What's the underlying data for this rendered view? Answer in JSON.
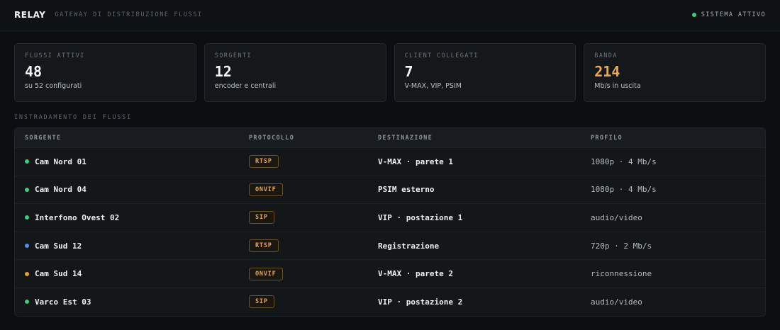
{
  "header": {
    "brand": "RELAY",
    "subtitle": "GATEWAY DI DISTRIBUZIONE FLUSSI",
    "status": "SISTEMA ATTIVO",
    "status_color": "#34d27b"
  },
  "cards": [
    {
      "label": "FLUSSI ATTIVI",
      "value": "48",
      "note": "su 52 configurati"
    },
    {
      "label": "SORGENTI",
      "value": "12",
      "note": "encoder e centrali"
    },
    {
      "label": "CLIENT COLLEGATI",
      "value": "7",
      "note": "V-MAX, VIP, PSIM"
    },
    {
      "label": "BANDA",
      "value": "214",
      "note": "Mb/s in uscita",
      "accent": "#f0a64a"
    }
  ],
  "routing": {
    "title": "INSTRADAMENTO DEI FLUSSI",
    "columns": [
      "SORGENTE",
      "PROTOCOLLO",
      "DESTINAZIONE",
      "PROFILO"
    ],
    "rows": [
      {
        "source": "Cam Nord 01",
        "status": "#34d27b",
        "protocol": "RTSP",
        "destination": "V-MAX · parete 1",
        "profile": "1080p · 4 Mb/s"
      },
      {
        "source": "Cam Nord 04",
        "status": "#34d27b",
        "protocol": "ONVIF",
        "destination": "PSIM esterno",
        "profile": "1080p · 4 Mb/s"
      },
      {
        "source": "Interfono Ovest 02",
        "status": "#34d27b",
        "protocol": "SIP",
        "destination": "VIP · postazione 1",
        "profile": "audio/video"
      },
      {
        "source": "Cam Sud 12",
        "status": "#4f8df0",
        "protocol": "RTSP",
        "destination": "Registrazione",
        "profile": "720p · 2 Mb/s"
      },
      {
        "source": "Cam Sud 14",
        "status": "#eba02f",
        "protocol": "ONVIF",
        "destination": "V-MAX · parete 2",
        "profile": "riconnessione"
      },
      {
        "source": "Varco Est 03",
        "status": "#34d27b",
        "protocol": "SIP",
        "destination": "VIP · postazione 2",
        "profile": "audio/video"
      }
    ]
  }
}
